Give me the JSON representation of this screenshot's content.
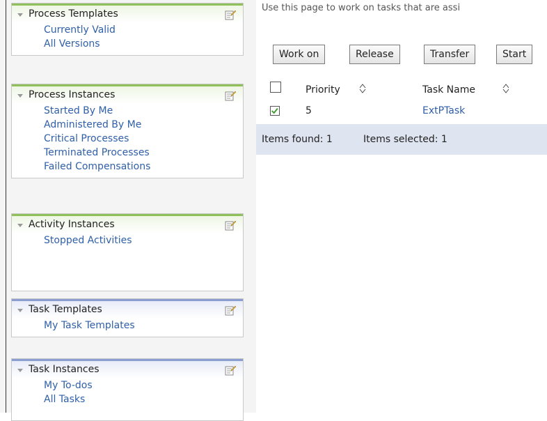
{
  "nav": {
    "panels": [
      {
        "title": "Process Templates",
        "items": [
          "Currently Valid",
          "All Versions"
        ]
      },
      {
        "title": "Process Instances",
        "items": [
          "Started By Me",
          "Administered By Me",
          "Critical Processes",
          "Terminated Processes",
          "Failed Compensations"
        ]
      },
      {
        "title": "Activity Instances",
        "items": [
          "Stopped Activities"
        ]
      },
      {
        "title": "Task Templates",
        "items": [
          "My Task Templates"
        ]
      },
      {
        "title": "Task Instances",
        "items": [
          "My To-dos",
          "All Tasks"
        ]
      }
    ]
  },
  "main": {
    "intro": "Use this page to work on tasks that are assi",
    "buttons": [
      "Work on",
      "Release",
      "Transfer",
      "Start"
    ],
    "columns": {
      "priority": "Priority",
      "task_name": "Task Name"
    },
    "rows": [
      {
        "priority": "5",
        "task_name": "ExtPTask",
        "selected": true
      }
    ],
    "footer": {
      "items_found": "Items found: 1",
      "items_selected": "Items selected: 1"
    }
  },
  "colors": {
    "link": "#2f5fa8",
    "green_header": "#8fc05a",
    "blue_header": "#8a9ed2",
    "footer_bg": "#dfe4f1",
    "check": "#3a9a2a"
  },
  "icons": {
    "panel_action": "edit-note-icon",
    "collapse": "triangle-down-icon",
    "sort": "sort-updown-icon",
    "check": "checkmark-icon"
  }
}
